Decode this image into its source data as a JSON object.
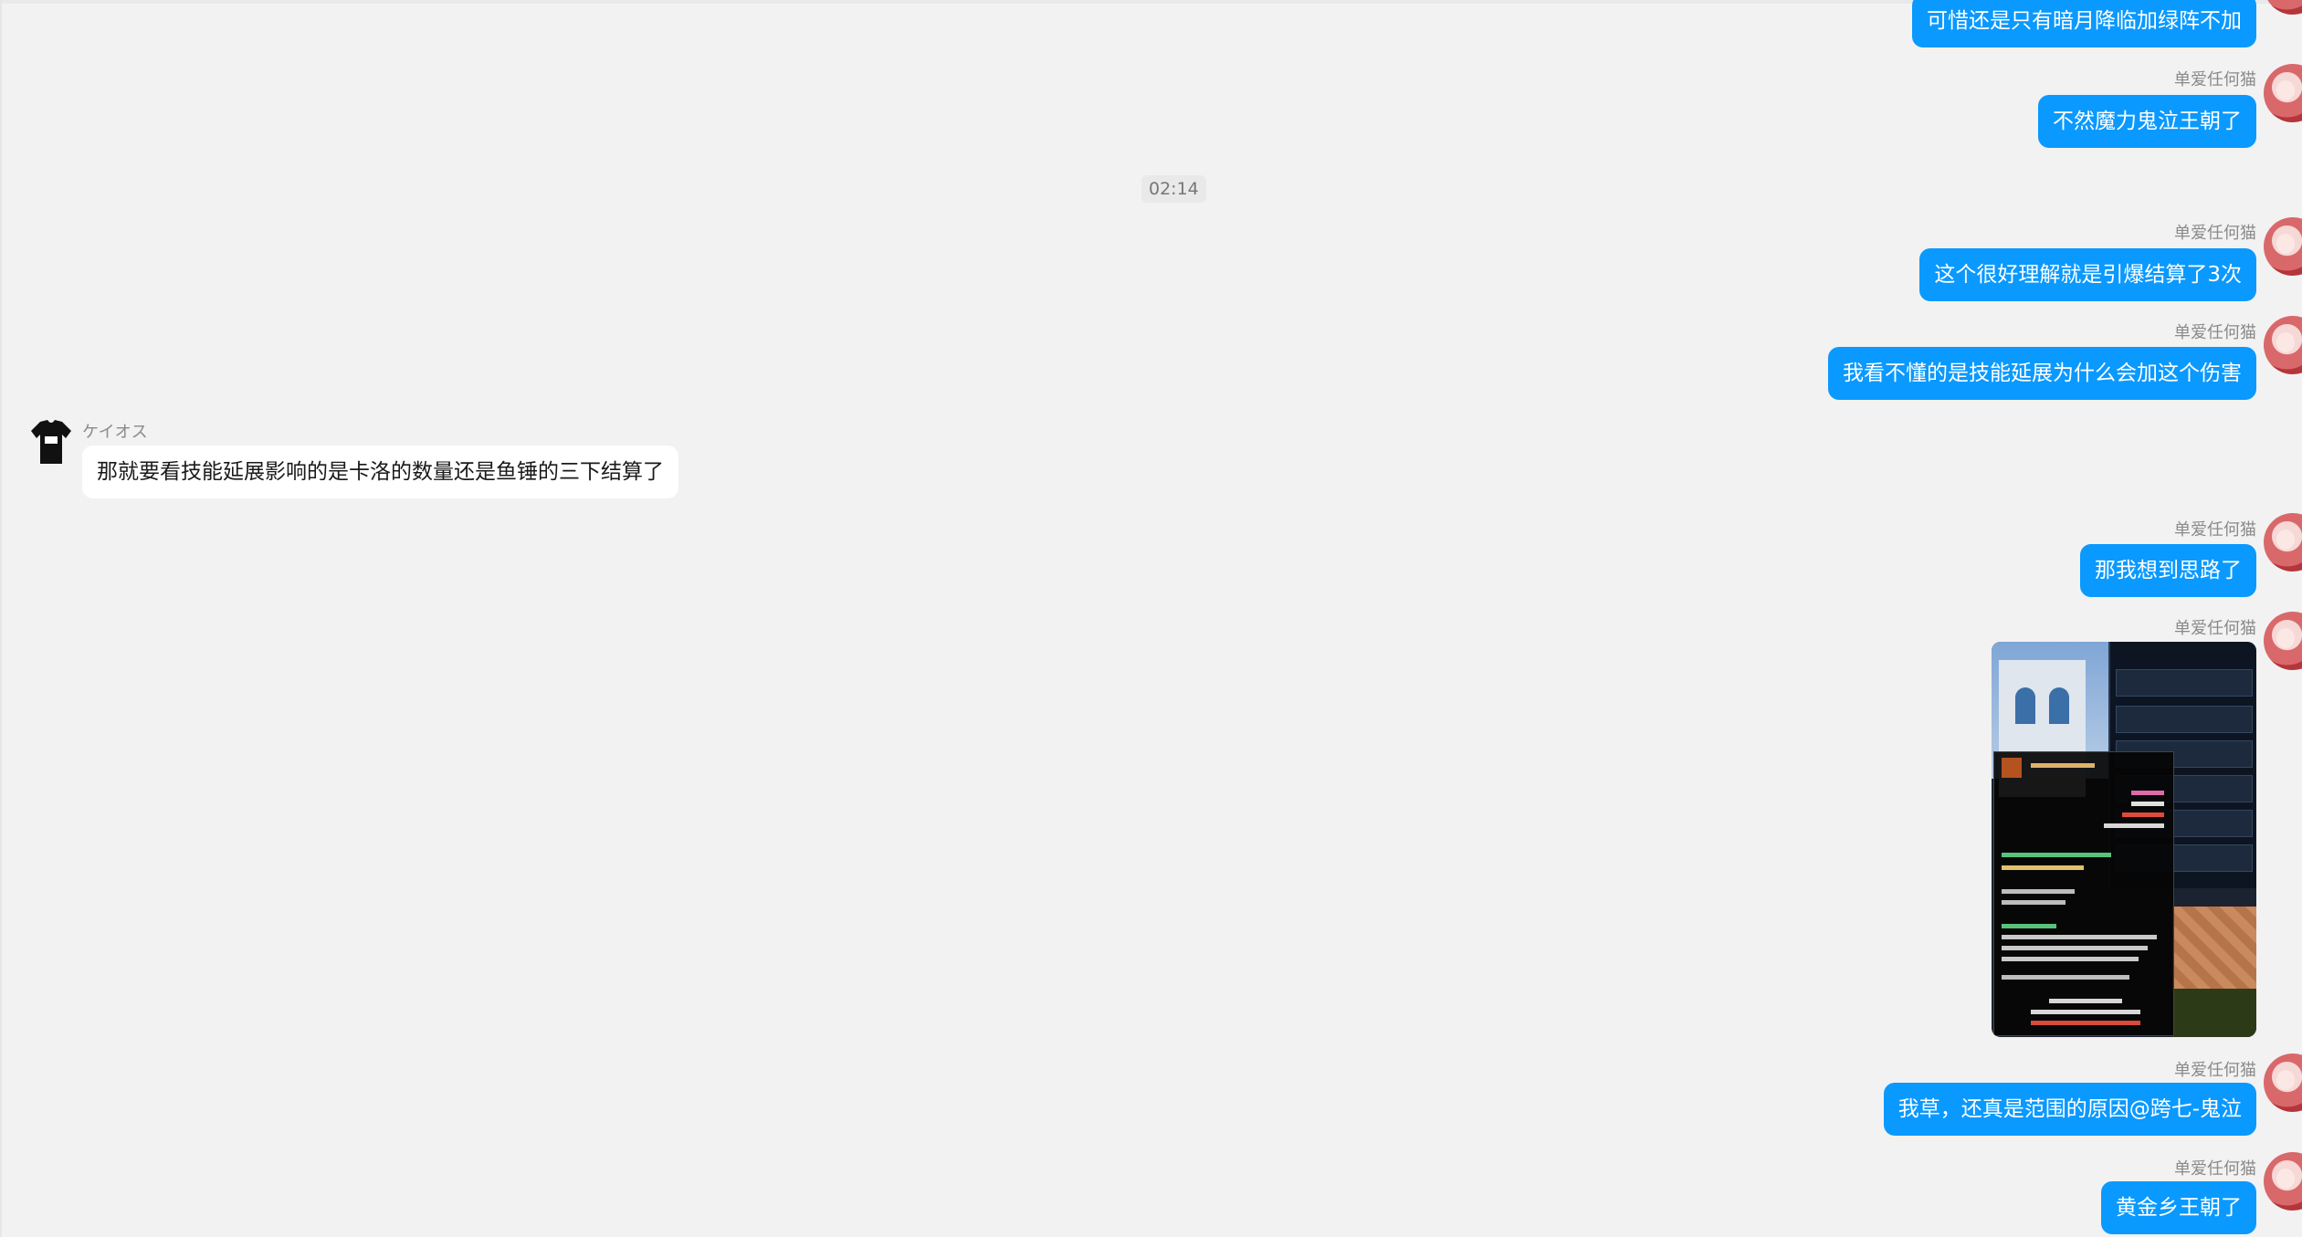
{
  "colors": {
    "background": "#f2f2f2",
    "outgoing_bubble": "#0a99ff",
    "incoming_bubble": "#ffffff",
    "name_text": "#8a8a8a"
  },
  "timestamp": "02:14",
  "messages": [
    {
      "side": "right",
      "sender": "",
      "text": "可惜还是只有暗月降临加绿阵不加"
    },
    {
      "side": "right",
      "sender": "单爱任何猫",
      "text": "不然魔力鬼泣王朝了"
    },
    {
      "side": "right",
      "sender": "单爱任何猫",
      "text": "这个很好理解就是引爆结算了3次"
    },
    {
      "side": "right",
      "sender": "单爱任何猫",
      "text": "我看不懂的是技能延展为什么会加这个伤害"
    },
    {
      "side": "left",
      "sender": "ケイオス",
      "text": "那就要看技能延展影响的是卡洛的数量还是鱼锤的三下结算了"
    },
    {
      "side": "right",
      "sender": "单爱任何猫",
      "text": "那我想到思路了"
    },
    {
      "side": "right",
      "sender": "单爱任何猫",
      "image": "game-screenshot"
    },
    {
      "side": "right",
      "sender": "单爱任何猫",
      "text": "我草，还真是范围的原因@跨七-鬼泣"
    },
    {
      "side": "right",
      "sender": "单爱任何猫",
      "text": "黄金乡王朝了"
    }
  ]
}
